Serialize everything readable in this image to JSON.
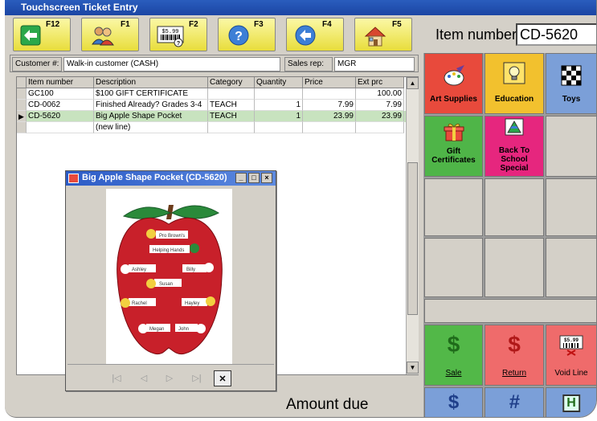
{
  "window": {
    "title": "Touchscreen Ticket Entry"
  },
  "toolbar": {
    "keys": [
      {
        "label": "F12",
        "icon": "back-arrow-icon"
      },
      {
        "label": "F1",
        "icon": "customers-icon"
      },
      {
        "label": "F2",
        "icon": "price-tag-icon",
        "price_text": "$5.99"
      },
      {
        "label": "F3",
        "icon": "help-icon"
      },
      {
        "label": "F4",
        "icon": "left-arrow-icon"
      },
      {
        "label": "F5",
        "icon": "home-icon"
      }
    ]
  },
  "item_number": {
    "label": "Item number",
    "value": "CD-5620"
  },
  "customer_bar": {
    "customer_label": "Customer #:",
    "customer_value": "Walk-in customer  (CASH)",
    "sales_rep_label": "Sales rep:",
    "sales_rep_value": "MGR"
  },
  "grid": {
    "columns": [
      "Item number",
      "Description",
      "Category",
      "Quantity",
      "Price",
      "Ext prc"
    ],
    "rows": [
      {
        "item": "GC100",
        "description": "$100 GIFT CERTIFICATE",
        "category": "",
        "quantity": "",
        "price": "",
        "ext": "100.00"
      },
      {
        "item": "CD-0062",
        "description": "Finished Already? Grades 3-4",
        "category": "TEACH",
        "quantity": "1",
        "price": "7.99",
        "ext": "7.99"
      },
      {
        "item": "CD-5620",
        "description": "Big Apple Shape Pocket",
        "category": "TEACH",
        "quantity": "1",
        "price": "23.99",
        "ext": "23.99",
        "selected": true
      },
      {
        "item": "",
        "description": "(new line)",
        "category": "",
        "quantity": "",
        "price": "",
        "ext": ""
      }
    ]
  },
  "amount_due": {
    "label": "Amount due"
  },
  "categories": [
    {
      "label": "Art Supplies",
      "color": "#e84a3c",
      "icon": "paint-palette-icon"
    },
    {
      "label": "Education",
      "color": "#f2c12e",
      "icon": "lightbulb-icon"
    },
    {
      "label": "Toys",
      "color": "#7b9fd8",
      "icon": "checkerboard-icon"
    },
    {
      "label": "Gift Certificates",
      "color": "#4fb548",
      "icon": "gift-icon"
    },
    {
      "label": "Back To School Special",
      "color": "#e6267e",
      "icon": "pyramid-icon"
    }
  ],
  "actions": [
    {
      "label": "Sale",
      "color": "#52b848",
      "icon": "dollar-icon"
    },
    {
      "label": "Return",
      "color": "#ef6b6b",
      "icon": "dollar-icon"
    },
    {
      "label": "Void Line",
      "color": "#ef6b6b",
      "icon": "price-tag-icon",
      "price_text": "$5.99"
    }
  ],
  "popup": {
    "title": "Big Apple Shape Pocket (CD-5620)",
    "image_names": [
      "Pro Brown's",
      "Helping Hands",
      "Ashley",
      "Billy",
      "Susan",
      "Rachel",
      "Hayley",
      "Megan",
      "John"
    ],
    "nav": [
      "first-icon",
      "previous-icon",
      "next-icon",
      "last-icon",
      "close-icon"
    ]
  }
}
